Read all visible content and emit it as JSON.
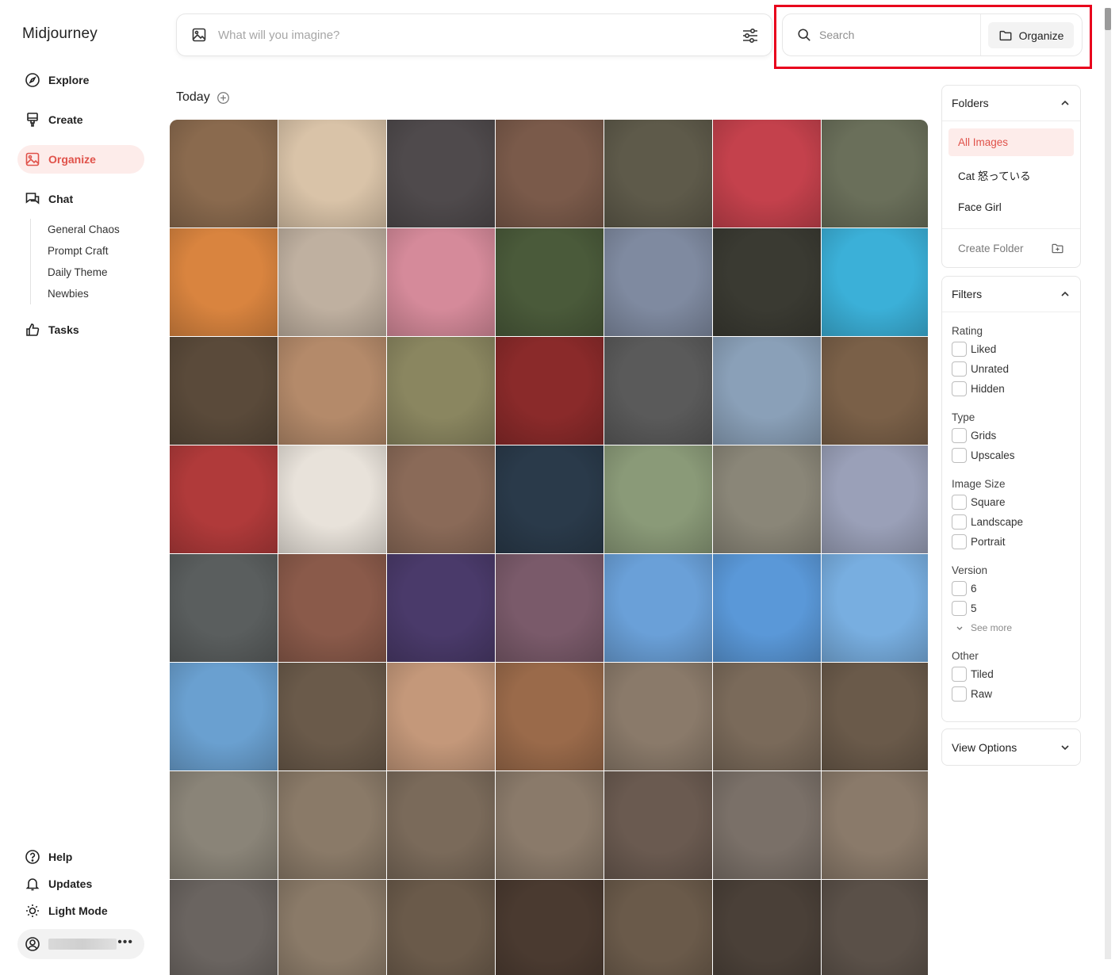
{
  "app": {
    "title": "Midjourney"
  },
  "nav": {
    "items": [
      {
        "label": "Explore",
        "icon": "compass-icon"
      },
      {
        "label": "Create",
        "icon": "brush-icon"
      },
      {
        "label": "Organize",
        "icon": "image-icon",
        "active": true
      },
      {
        "label": "Chat",
        "icon": "chat-icon"
      }
    ],
    "chat_channels": [
      "General Chaos",
      "Prompt Craft",
      "Daily Theme",
      "Newbies"
    ],
    "tasks": {
      "label": "Tasks",
      "icon": "thumbs-up-icon"
    },
    "bottom": [
      {
        "label": "Help",
        "icon": "help-icon"
      },
      {
        "label": "Updates",
        "icon": "bell-icon"
      },
      {
        "label": "Light Mode",
        "icon": "sun-icon"
      }
    ],
    "user_menu_icon": "more-dots-icon"
  },
  "prompt": {
    "placeholder": "What will you imagine?"
  },
  "search": {
    "placeholder": "Search",
    "organize_label": "Organize"
  },
  "section": {
    "title": "Today"
  },
  "folders": {
    "title": "Folders",
    "items": [
      "All Images",
      "Cat 怒っている",
      "Face Girl"
    ],
    "active_index": 0,
    "create_label": "Create Folder"
  },
  "filters": {
    "title": "Filters",
    "groups": [
      {
        "title": "Rating",
        "options": [
          "Liked",
          "Unrated",
          "Hidden"
        ]
      },
      {
        "title": "Type",
        "options": [
          "Grids",
          "Upscales"
        ]
      },
      {
        "title": "Image Size",
        "options": [
          "Square",
          "Landscape",
          "Portrait"
        ]
      },
      {
        "title": "Version",
        "options": [
          "6",
          "5"
        ],
        "see_more": "See more"
      },
      {
        "title": "Other",
        "options": [
          "Tiled",
          "Raw"
        ]
      }
    ]
  },
  "view_options": {
    "title": "View Options"
  },
  "colors": {
    "accent": "#e0524a",
    "accent_bg": "#fdecea",
    "highlight_box": "#e8001c"
  },
  "gallery": {
    "tiles": [
      "#8a6a4e",
      "#d9c3a8",
      "#4f4a4c",
      "#7a5a4a",
      "#5e5a4a",
      "#c4414c",
      "#6a6f5a",
      "#d9843f",
      "#bfb0a0",
      "#d58a9a",
      "#4a5a3a",
      "#7f8aa0",
      "#3a3a32",
      "#3bb0d8",
      "#5a4a3a",
      "#b48a6a",
      "#8a8660",
      "#8a2a2a",
      "#5a5a5a",
      "#8aa0b8",
      "#7a6048",
      "#b03a3a",
      "#e8e2da",
      "#8a6a58",
      "#2a3a4a",
      "#8a9a78",
      "#8a8678",
      "#9aa0b8",
      "#5a5e5e",
      "#8a5a4a",
      "#4a3a6a",
      "#7a5a6a",
      "#6aa0d8",
      "#5a98d8",
      "#78aee0",
      "#6aa0d0",
      "#6a5a4a",
      "#c4987a",
      "#9a6a4a",
      "#8a7a6a",
      "#7a6a5a",
      "#6a5a4a",
      "#8a8478",
      "#8a7a68",
      "#7a6a5a",
      "#8a7a6a",
      "#6a5a50",
      "#7a7068",
      "#8a7a6a",
      "#6a6460",
      "#8a7a68",
      "#6a5a4a",
      "#4a3a30",
      "#6a5a4a",
      "#4a4038",
      "#5a5048"
    ]
  }
}
